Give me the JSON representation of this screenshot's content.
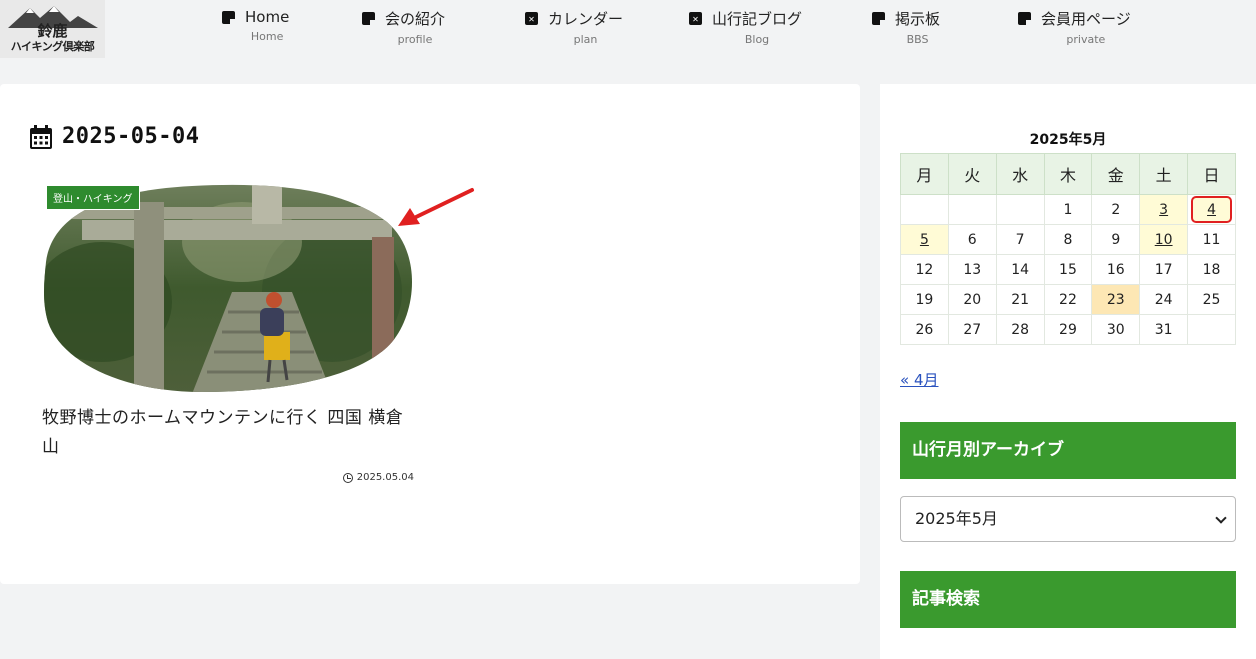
{
  "logo": {
    "line1": "鈴鹿",
    "line2": "ハイキング倶楽部"
  },
  "nav": [
    {
      "label": "Home",
      "sub": "Home",
      "icon": "note-icon"
    },
    {
      "label": "会の紹介",
      "sub": "profile",
      "icon": "note-icon"
    },
    {
      "label": "カレンダー",
      "sub": "plan",
      "icon": "calendar-x-icon"
    },
    {
      "label": "山行記ブログ",
      "sub": "Blog",
      "icon": "calendar-x-icon"
    },
    {
      "label": "掲示板",
      "sub": "BBS",
      "icon": "note-icon"
    },
    {
      "label": "会員用ページ",
      "sub": "private",
      "icon": "note-icon"
    }
  ],
  "archive": {
    "heading": "2025-05-04"
  },
  "post": {
    "category": "登山・ハイキング",
    "title": "牧野博士のホームマウンテンに行く 四国 横倉山",
    "date": "2025.05.04"
  },
  "calendar": {
    "caption": "2025年5月",
    "weekdays": [
      "月",
      "火",
      "水",
      "木",
      "金",
      "土",
      "日"
    ],
    "weeks": [
      [
        "",
        "",
        "",
        "1",
        "2",
        "3",
        "4"
      ],
      [
        "5",
        "6",
        "7",
        "8",
        "9",
        "10",
        "11"
      ],
      [
        "12",
        "13",
        "14",
        "15",
        "16",
        "17",
        "18"
      ],
      [
        "19",
        "20",
        "21",
        "22",
        "23",
        "24",
        "25"
      ],
      [
        "26",
        "27",
        "28",
        "29",
        "30",
        "31",
        ""
      ]
    ],
    "linked_days": [
      "3",
      "4",
      "5",
      "10"
    ],
    "highlight_today": "23",
    "circled_day": "4",
    "prev_link": "« 4月"
  },
  "widgets": {
    "archive_title": "山行月別アーカイブ",
    "archive_select_value": "2025年5月",
    "search_title": "記事検索"
  },
  "colors": {
    "accent_green": "#3a9a2e",
    "calendar_header": "#e8f3e5",
    "link_day_bg": "#fffbd6",
    "today_bg": "#fde7b4",
    "annotation_red": "#e02020"
  }
}
